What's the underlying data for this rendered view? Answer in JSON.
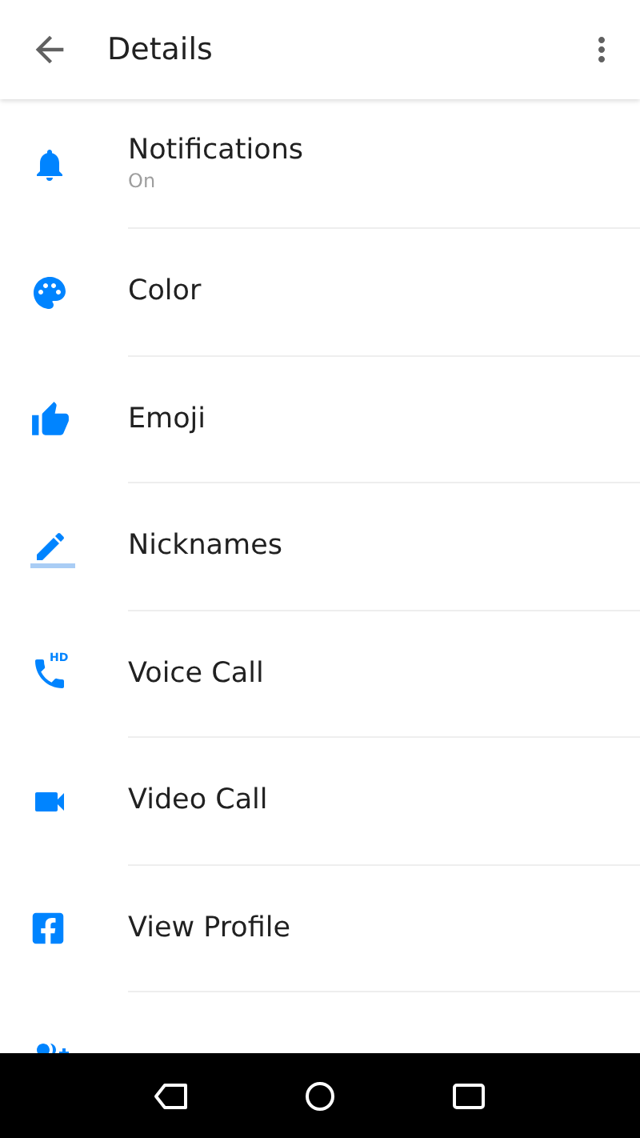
{
  "header": {
    "title": "Details"
  },
  "items": [
    {
      "label": "Notifications",
      "subtitle": "On"
    },
    {
      "label": "Color"
    },
    {
      "label": "Emoji"
    },
    {
      "label": "Nicknames"
    },
    {
      "label": "Voice Call",
      "badge": "HD"
    },
    {
      "label": "Video Call"
    },
    {
      "label": "View Profile"
    }
  ]
}
